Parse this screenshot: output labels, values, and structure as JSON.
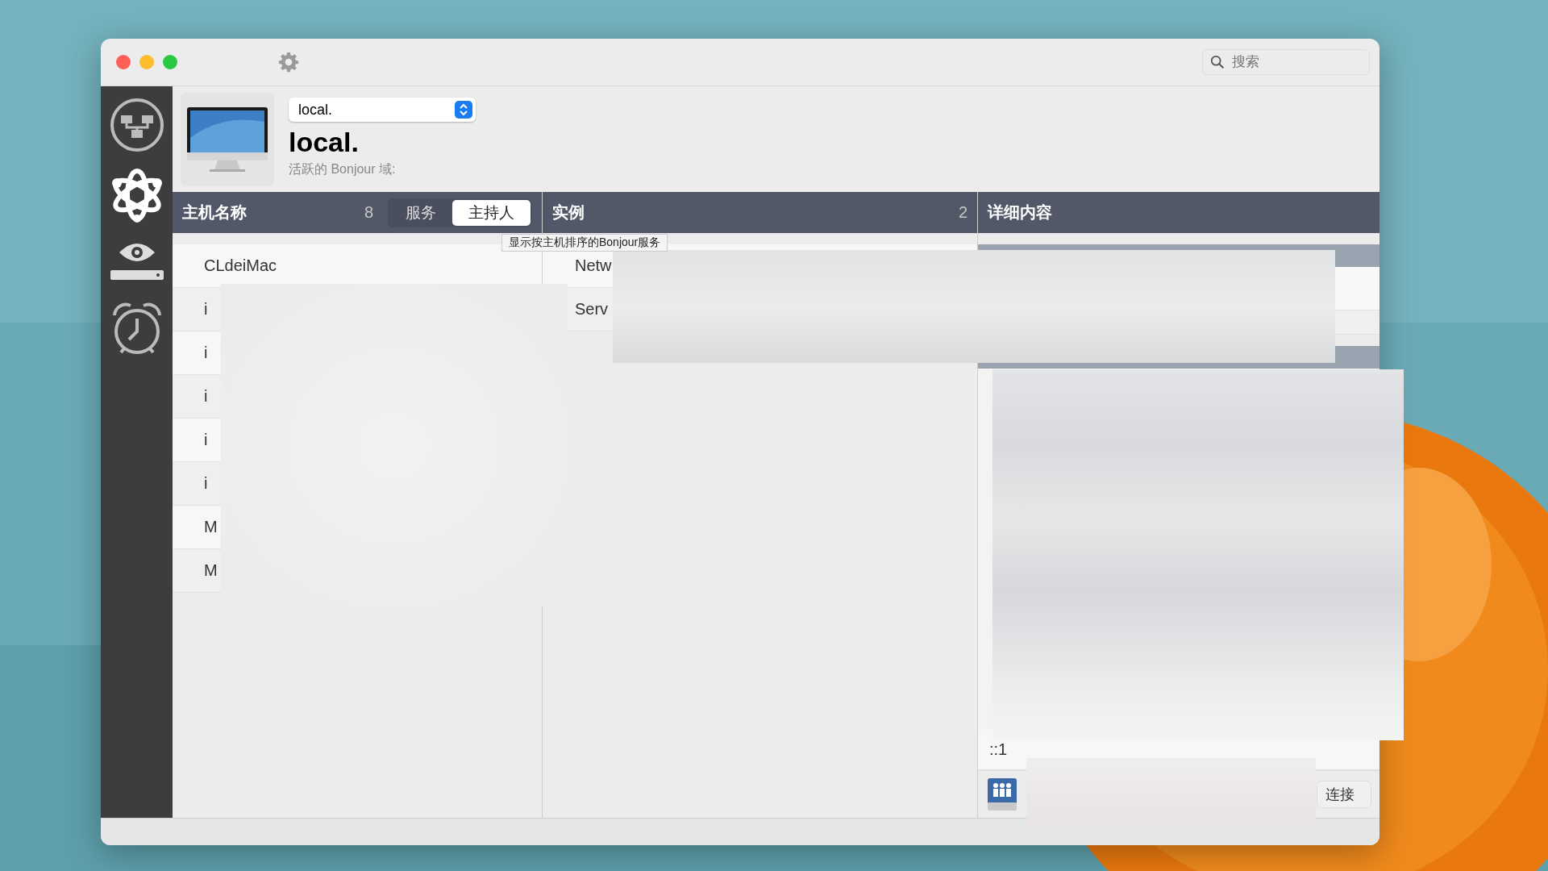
{
  "search": {
    "placeholder": "搜索"
  },
  "domain": {
    "dropdown_value": "local.",
    "title": "local.",
    "subtitle": "活跃的 Bonjour 域:"
  },
  "hosts": {
    "heading": "主机名称",
    "count": "8",
    "segments": [
      {
        "label": "服务",
        "selected": false
      },
      {
        "label": "主持人",
        "selected": true
      }
    ],
    "tooltip": "显示按主机排序的Bonjour服务",
    "rows": [
      "CLdeiMac",
      "i",
      "i",
      "i",
      "i",
      "i",
      "M",
      "M"
    ]
  },
  "instances": {
    "heading": "实例",
    "count": "2",
    "rows": [
      "Netw",
      "Serv"
    ]
  },
  "details": {
    "heading": "详细内容",
    "address": "::1",
    "connect_button": "连接"
  }
}
